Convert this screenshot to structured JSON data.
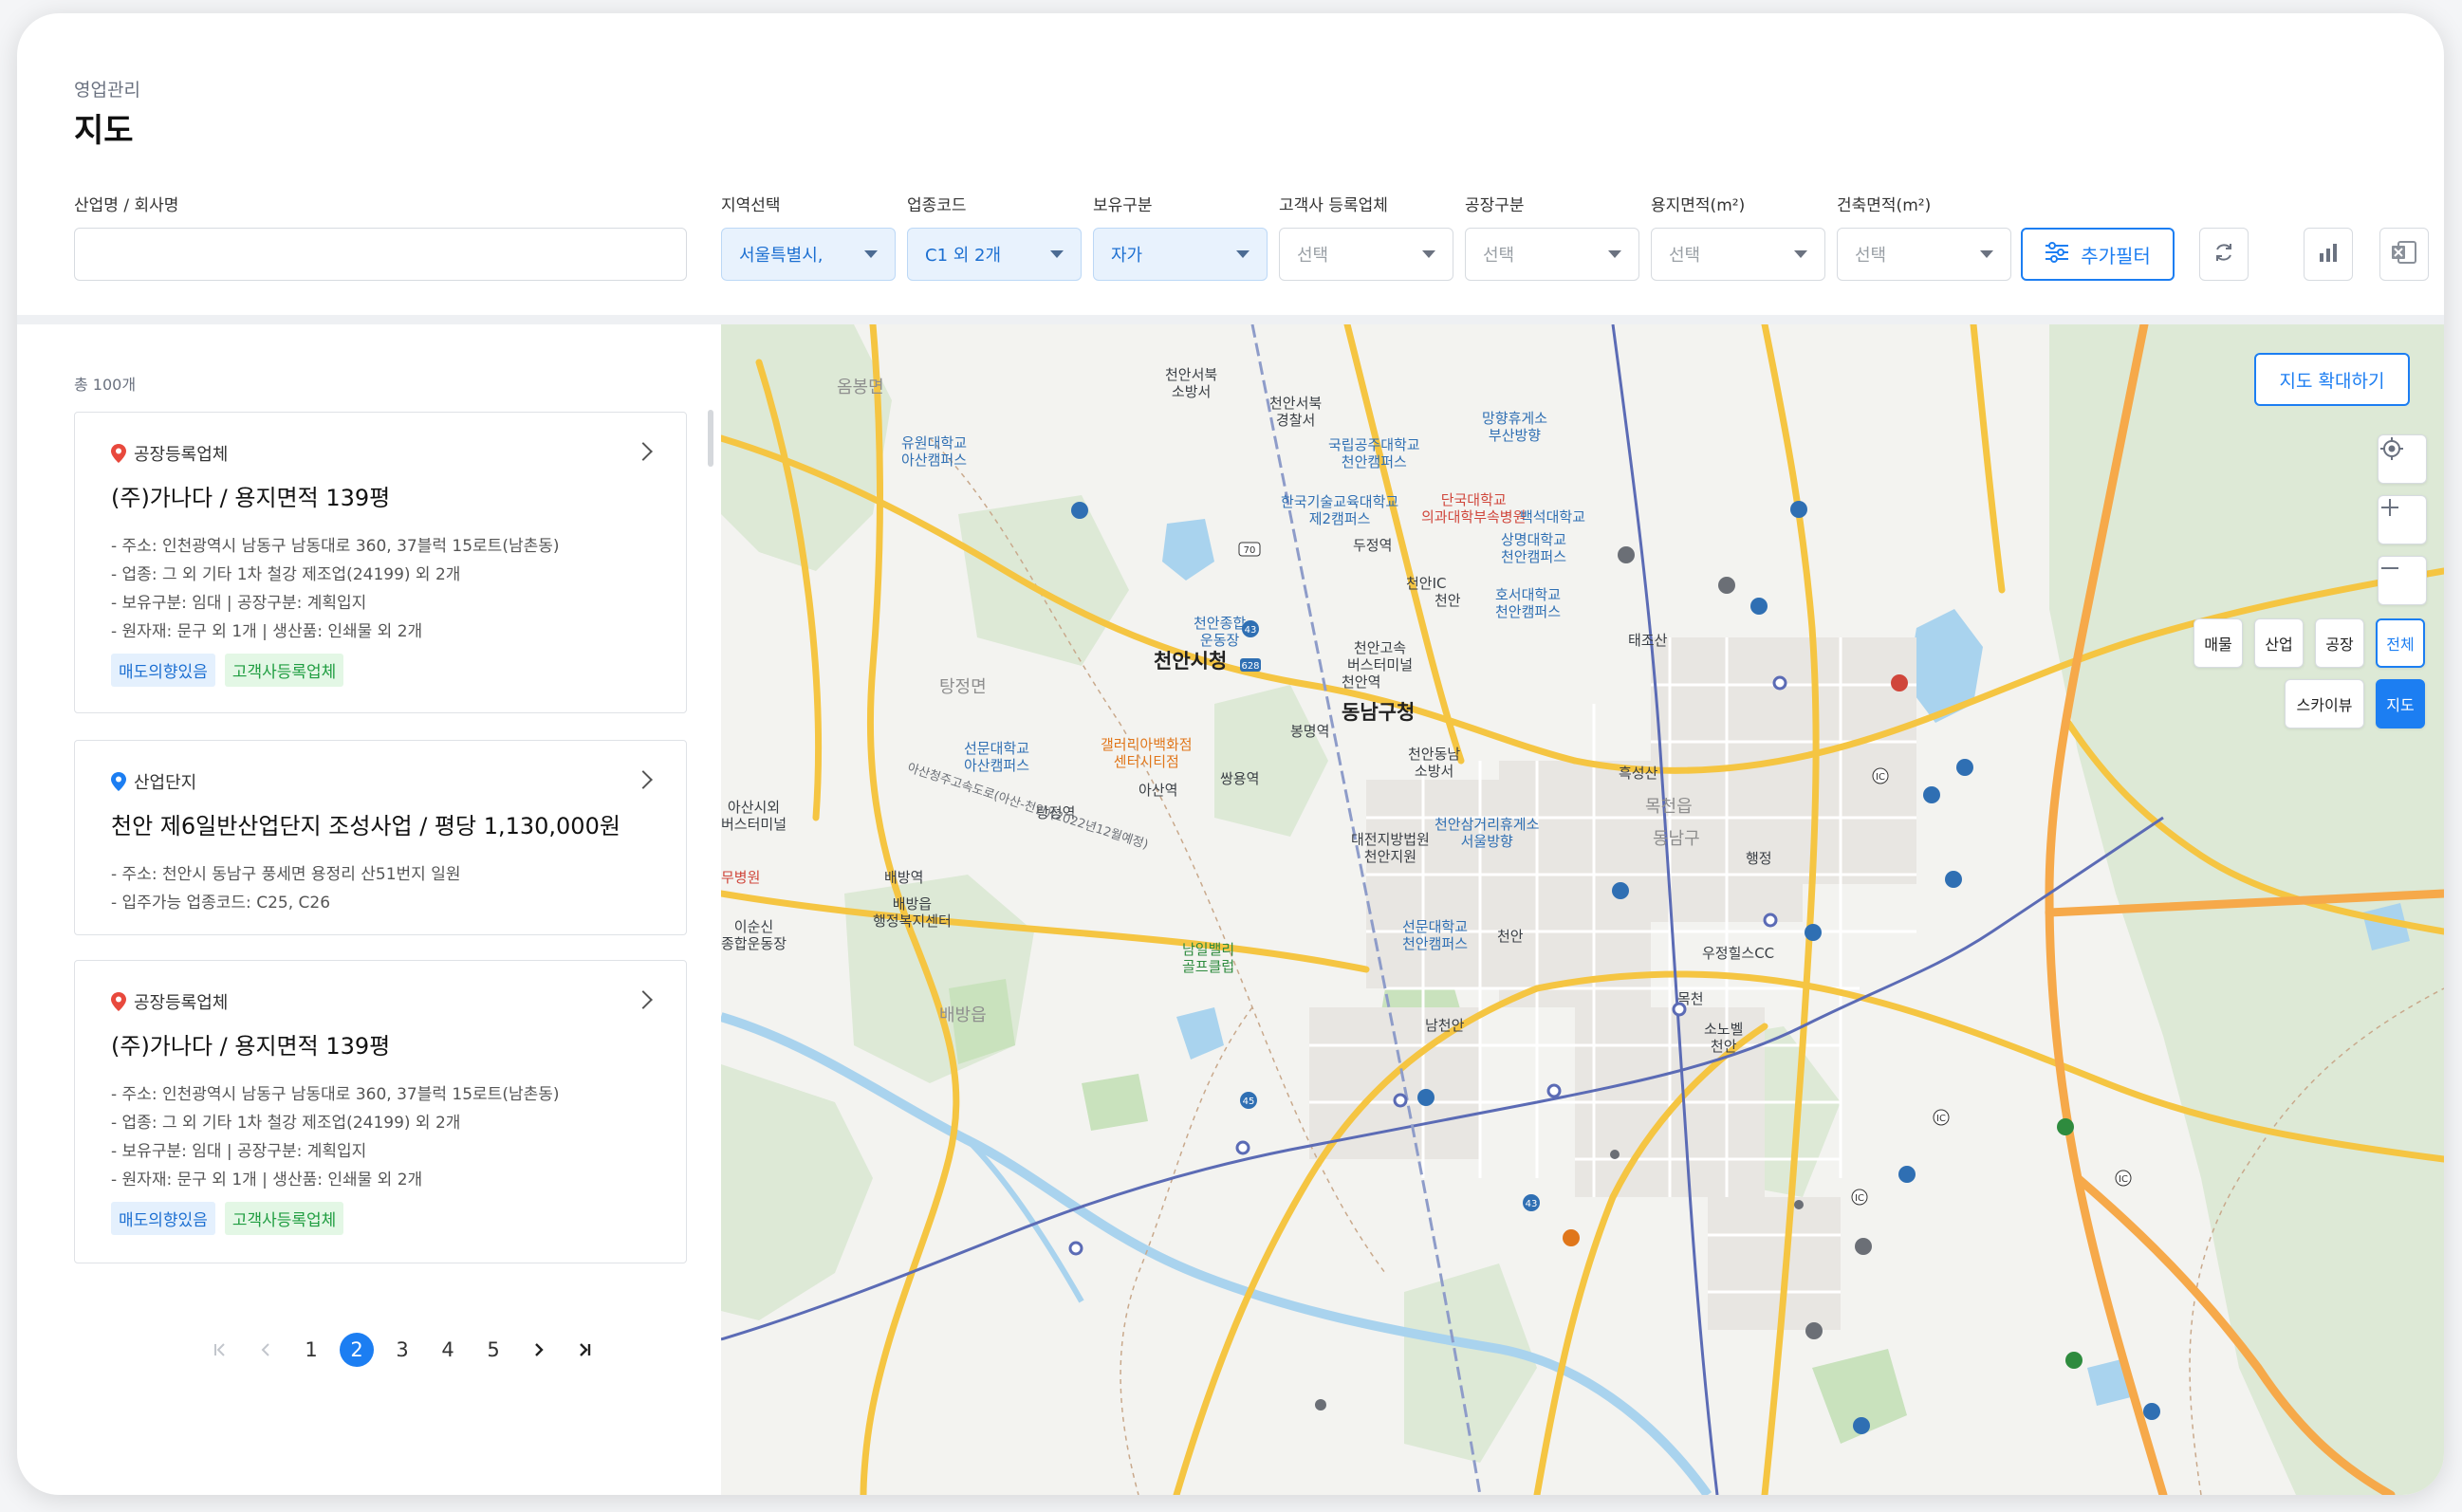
{
  "header": {
    "breadcrumb": "영업관리",
    "title": "지도"
  },
  "filters": {
    "company_label": "산업명 / 회사명",
    "company_value": "",
    "region_label": "지역선택",
    "region_value": "서울특별시,",
    "industry_label": "업종코드",
    "industry_value": "C1 외 2개",
    "ownership_label": "보유구분",
    "ownership_value": "자가",
    "client_label": "고객사 등록업체",
    "client_value": "선택",
    "factory_label": "공장구분",
    "factory_value": "선택",
    "land_label": "용지면적(m²)",
    "land_value": "선택",
    "building_label": "건축면적(m²)",
    "building_value": "선택",
    "add_filter_label": "추가필터"
  },
  "list": {
    "total": "총 100개",
    "cards": [
      {
        "type": "공장등록업체",
        "pin_color": "#e8493d",
        "title": "(주)가나다 / 용지면적 139평",
        "details": [
          "- 주소: 인천광역시 남동구 남동대로 360, 37블럭 15로트(남촌동)",
          "- 업종: 그 외 기타 1차 철강 제조업(24199) 외 2개",
          "- 보유구분: 임대 | 공장구분: 계획입지",
          "- 원자재: 문구 외 1개 | 생산품: 인쇄물 외 2개"
        ],
        "tags": [
          "매도의향있음",
          "고객사등록업체"
        ]
      },
      {
        "type": "산업단지",
        "pin_color": "#1c7ef2",
        "title": "천안 제6일반산업단지 조성사업 / 평당 1,130,000원",
        "details": [
          "- 주소: 천안시 동남구 풍세면 용정리 산51번지 일원",
          "- 입주가능 업종코드: C25, C26"
        ],
        "tags": []
      },
      {
        "type": "공장등록업체",
        "pin_color": "#e8493d",
        "title": "(주)가나다 / 용지면적 139평",
        "details": [
          "- 주소: 인천광역시 남동구 남동대로 360, 37블럭 15로트(남촌동)",
          "- 업종: 그 외 기타 1차 철강 제조업(24199) 외 2개",
          "- 보유구분: 임대 | 공장구분: 계획입지",
          "- 원자재: 문구 외 1개 | 생산품: 인쇄물 외 2개"
        ],
        "tags": [
          "매도의향있음",
          "고객사등록업체"
        ]
      }
    ]
  },
  "pagination": {
    "pages": [
      "1",
      "2",
      "3",
      "4",
      "5"
    ],
    "current": "2"
  },
  "map": {
    "expand_label": "지도 확대하기",
    "layer_buttons": [
      "매물",
      "산업",
      "공장",
      "전체"
    ],
    "layer_selected": "전체",
    "view_buttons": [
      "스카이뷰",
      "지도"
    ],
    "view_selected": "지도",
    "labels": {
      "l1": "옴봉면",
      "l2": "천안서북\n소방서",
      "l3": "천안서북\n경찰서",
      "l4": "망향휴게소\n부산방향",
      "l5": "유원대학교\n아산캠퍼스",
      "l6": "국립공주대학교\n천안캠퍼스",
      "l7": "한국기술교육대학교\n제2캠퍼스",
      "l8": "단국대학교\n의과대학부속병원",
      "l9": "백석대학교",
      "l10": "상명대학교\n천안캠퍼스",
      "l11": "두정역",
      "l12": "천안",
      "l13": "호서대학교\n천안캠퍼스",
      "l14": "천안종합\n운동장",
      "l15": "천안고속\n버스터미널",
      "l16": "태조산",
      "l17": "천안시청",
      "l18": "천안역",
      "l19": "탕정면",
      "l20": "동남구청",
      "l21": "봉명역",
      "l22": "선문대학교\n아산캠퍼스",
      "l23": "갤러리아백화점\n센터시티점",
      "l24": "천안동남\n소방서",
      "l25": "쌍용역",
      "l26": "아산역",
      "l27": "흑성산",
      "l28": "탕정역",
      "l29": "목천읍",
      "l30": "천안삼거리휴게소\n서울방향",
      "l31": "대전지방법원\n천안지원",
      "l32": "동남구",
      "l33": "배방역",
      "l34": "배방읍\n행정복지센터",
      "l35": "선문대학교\n천안캠퍼스",
      "l36": "천안",
      "l37": "우정힐스CC",
      "l38": "남일밸리\n골프클럽",
      "l39": "목천",
      "l40": "소노벨\n천안",
      "l41": "배방읍",
      "l42": "아산시외\n버스터미널",
      "l43": "무병원",
      "l44": "이순신\n종합운동장",
      "l45": "천안IC",
      "l46": "아산청주고속도로(아산-천안)(2022년12월예정)",
      "l47": "남천안",
      "l48": "행정"
    }
  },
  "colors": {
    "accent": "#1c7ef2",
    "road_major": "#f5c542",
    "road_minor": "#ffffff",
    "water": "#a9d3ee",
    "park": "#cfe5c4",
    "highway": "#f6a94a",
    "railway": "#5b6bb5"
  }
}
